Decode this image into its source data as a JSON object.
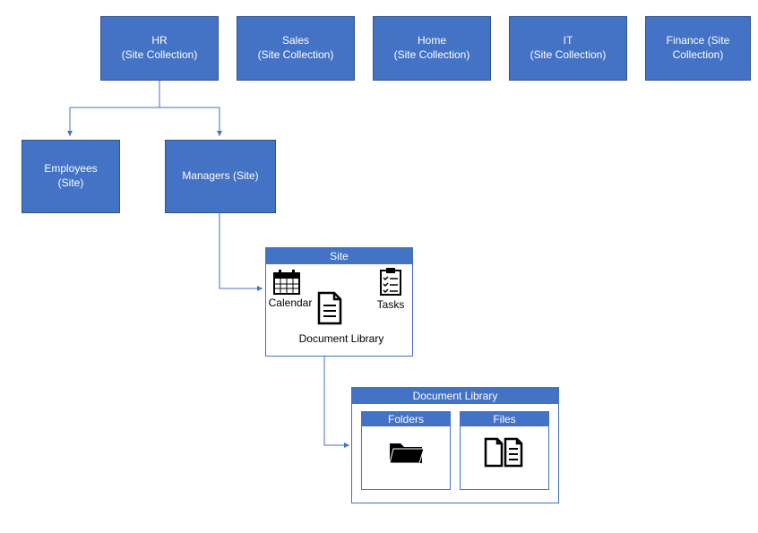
{
  "colors": {
    "primary": "#4472C4",
    "border": "#2F528F"
  },
  "siteCollections": [
    {
      "line1": "HR",
      "line2": "(Site Collection)"
    },
    {
      "line1": "Sales",
      "line2": "(Site Collection)"
    },
    {
      "line1": "Home",
      "line2": "(Site Collection)"
    },
    {
      "line1": "IT",
      "line2": "(Site Collection)"
    },
    {
      "line1": "Finance (Site",
      "line2": "Collection)"
    }
  ],
  "subsites": [
    {
      "line1": "Employees",
      "line2": "(Site)"
    },
    {
      "line1": "Managers (Site)",
      "line2": ""
    }
  ],
  "sitePanel": {
    "title": "Site",
    "items": {
      "calendar": "Calendar",
      "tasks": "Tasks",
      "docLibrary": "Document Library"
    }
  },
  "docLibPanel": {
    "title": "Document Library",
    "folders": "Folders",
    "files": "Files"
  },
  "icons": {
    "calendar": "calendar-icon",
    "tasks": "tasks-icon",
    "document": "document-icon",
    "folder": "folder-icon",
    "file": "file-icon"
  }
}
